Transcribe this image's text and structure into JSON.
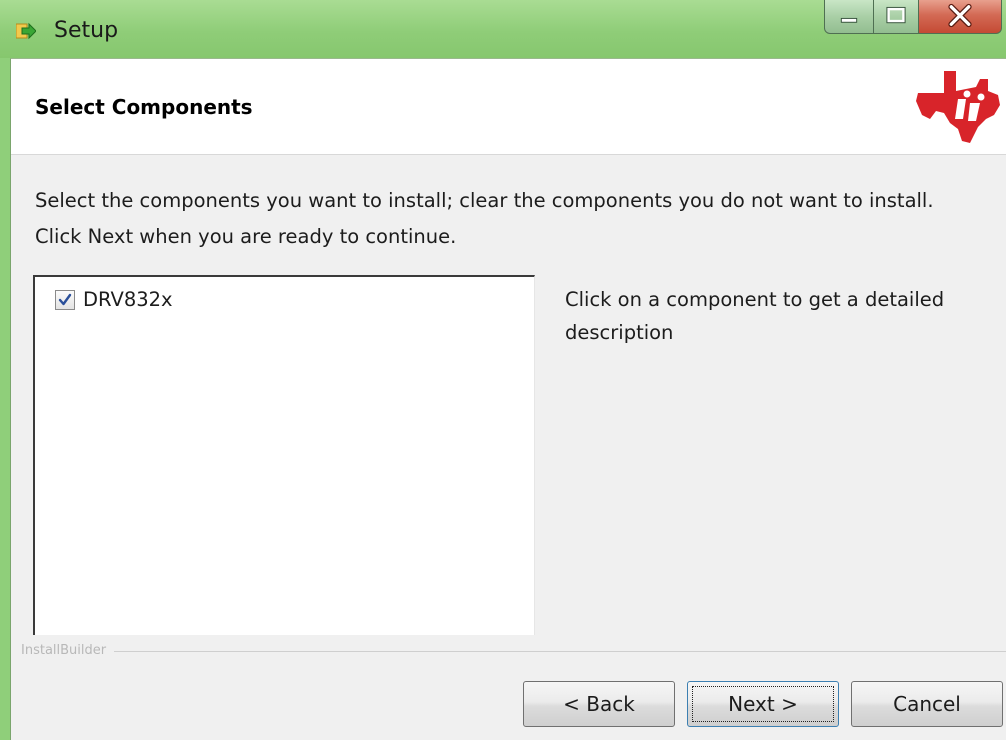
{
  "window": {
    "title": "Setup",
    "icon": "setup-arrow-icon",
    "caption_buttons": [
      "minimize-icon",
      "maximize-icon",
      "close-icon"
    ]
  },
  "header": {
    "title": "Select Components",
    "logo": "ti-logo"
  },
  "instructions": "Select the components you want to install; clear the components you do not want to install. Click Next when you are ready to continue.",
  "components": [
    {
      "label": "DRV832x",
      "checked": true
    }
  ],
  "description": "Click on a component to get a detailed description",
  "branding": "InstallBuilder",
  "buttons": {
    "back": "< Back",
    "next": "Next >",
    "cancel": "Cancel"
  },
  "colors": {
    "titlebar": "#8fcd78",
    "close_button": "#c44a34",
    "logo_red": "#d8242a",
    "dialog_bg": "#f0f0f0"
  }
}
